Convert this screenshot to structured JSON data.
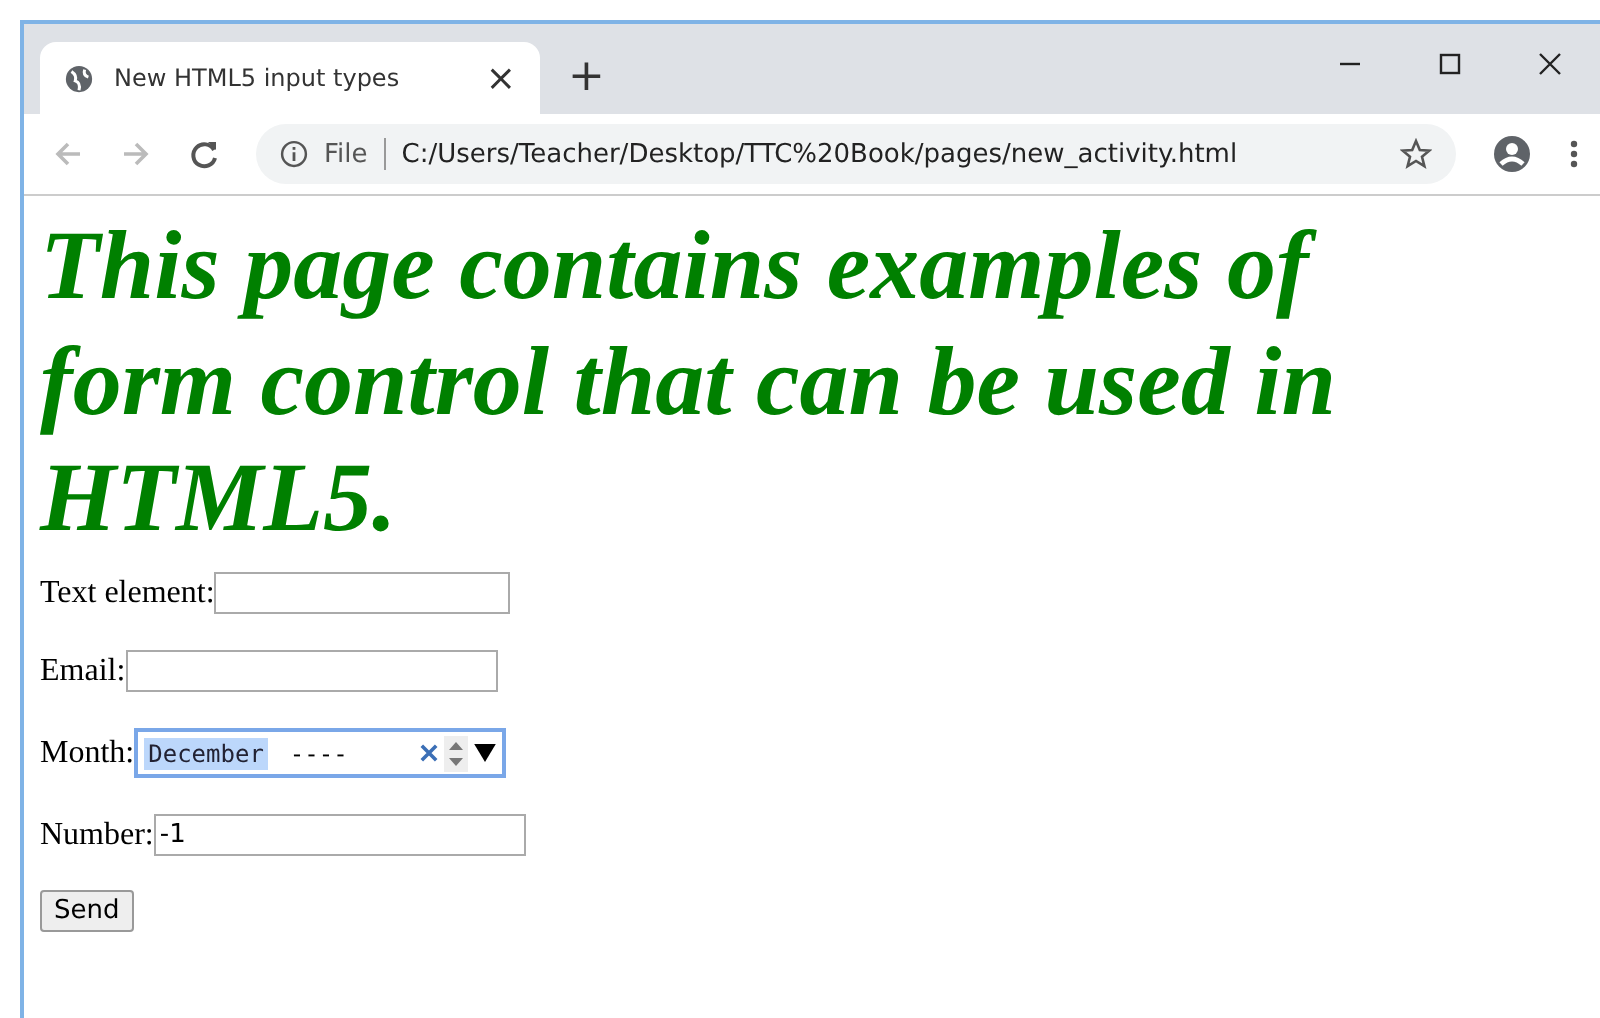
{
  "tab": {
    "title": "New HTML5 input types",
    "close": "×",
    "selected": true
  },
  "new_tab": "+",
  "address_bar": {
    "scheme": "File",
    "url": "C:/Users/Teacher/Desktop/TTC%20Book/pages/new_activity.html"
  },
  "heading": "This page contains examples of form control that can be used in HTML5.",
  "fields": [
    {
      "kind": "text",
      "label": "Text element:"
    },
    {
      "kind": "email",
      "label": "Email:"
    },
    {
      "kind": "month",
      "label": "Month:",
      "month": "December",
      "year": "----",
      "focused": true
    },
    {
      "kind": "number",
      "label": "Number:",
      "value": "-1"
    }
  ],
  "submit": "Send"
}
